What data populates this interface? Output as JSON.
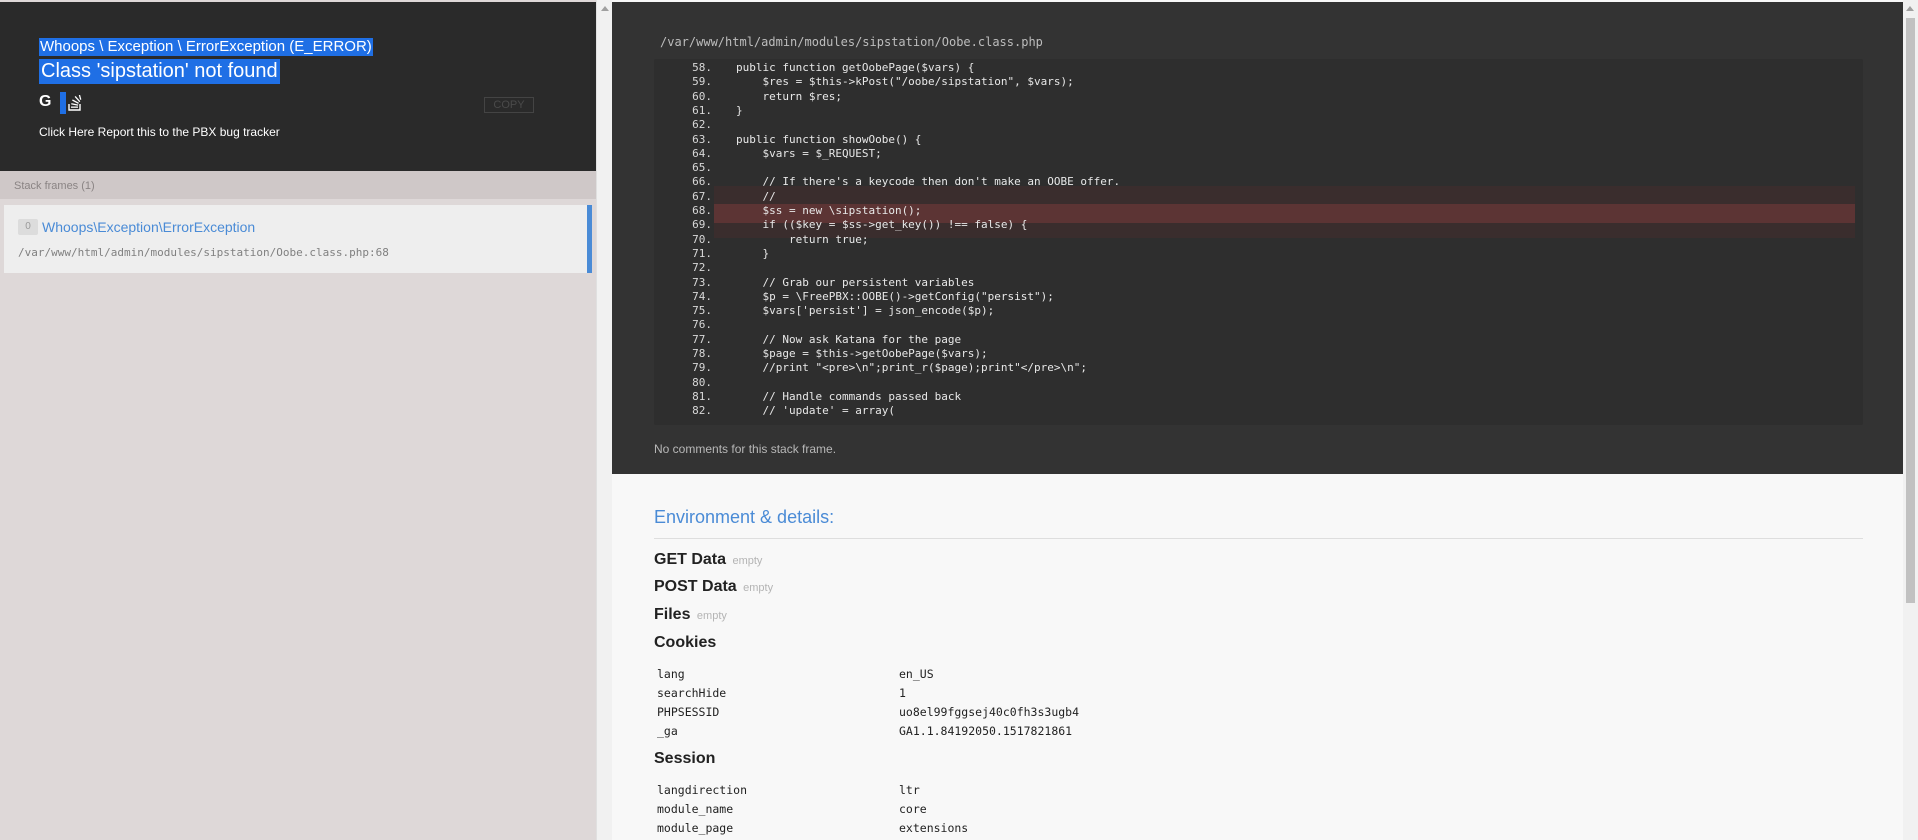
{
  "exception": {
    "type": "Whoops \\ Exception \\ ErrorException (E_ERROR)",
    "message": "Class 'sipstation' not found",
    "copy_label": "COPY",
    "google_glyph": "G",
    "bug_tracker": "Click Here Report this to the PBX bug tracker"
  },
  "frames": {
    "header": "Stack frames (1)",
    "items": [
      {
        "index": "0",
        "class": "Whoops\\Exception\\ErrorException",
        "file": "/var/www/html/admin/modules/sipstation/Oobe.class.php:68"
      }
    ]
  },
  "code": {
    "file_path": "/var/www/html/admin/modules/sipstation/Oobe.class.php",
    "lines": [
      {
        "n": "58.",
        "text": "public function getOobePage($vars) {"
      },
      {
        "n": "59.",
        "text": "    $res = $this->kPost(\"/oobe/sipstation\", $vars);"
      },
      {
        "n": "60.",
        "text": "    return $res;"
      },
      {
        "n": "61.",
        "text": "}"
      },
      {
        "n": "62.",
        "text": ""
      },
      {
        "n": "63.",
        "text": "public function showOobe() {"
      },
      {
        "n": "64.",
        "text": "    $vars = $_REQUEST;"
      },
      {
        "n": "65.",
        "text": ""
      },
      {
        "n": "66.",
        "text": "    // If there's a keycode then don't make an OOBE offer."
      },
      {
        "n": "67.",
        "text": "    //"
      },
      {
        "n": "68.",
        "text": "    $ss = new \\sipstation();"
      },
      {
        "n": "69.",
        "text": "    if (($key = $ss->get_key()) !== false) {"
      },
      {
        "n": "70.",
        "text": "        return true;"
      },
      {
        "n": "71.",
        "text": "    }"
      },
      {
        "n": "72.",
        "text": ""
      },
      {
        "n": "73.",
        "text": "    // Grab our persistent variables"
      },
      {
        "n": "74.",
        "text": "    $p = \\FreePBX::OOBE()->getConfig(\"persist\");"
      },
      {
        "n": "75.",
        "text": "    $vars['persist'] = json_encode($p);"
      },
      {
        "n": "76.",
        "text": ""
      },
      {
        "n": "77.",
        "text": "    // Now ask Katana for the page"
      },
      {
        "n": "78.",
        "text": "    $page = $this->getOobePage($vars);"
      },
      {
        "n": "79.",
        "text": "    //print \"<pre>\\n\";print_r($page);print\"</pre>\\n\";"
      },
      {
        "n": "80.",
        "text": ""
      },
      {
        "n": "81.",
        "text": "    // Handle commands passed back"
      },
      {
        "n": "82.",
        "text": "    // 'update' = array("
      }
    ],
    "no_comments": "No comments for this stack frame."
  },
  "env": {
    "title": "Environment & details:",
    "empty_label": "empty",
    "get": "GET Data",
    "post": "POST Data",
    "files": "Files",
    "cookies_title": "Cookies",
    "cookies": [
      {
        "k": "lang",
        "v": "en_US"
      },
      {
        "k": "searchHide",
        "v": "1"
      },
      {
        "k": "PHPSESSID",
        "v": "uo8el99fggsej40c0fh3s3ugb4"
      },
      {
        "k": "_ga",
        "v": "GA1.1.84192050.1517821861"
      }
    ],
    "session_title": "Session",
    "session": [
      {
        "k": "langdirection",
        "v": "ltr"
      },
      {
        "k": "module_name",
        "v": "core"
      },
      {
        "k": "module_page",
        "v": "extensions"
      }
    ]
  }
}
